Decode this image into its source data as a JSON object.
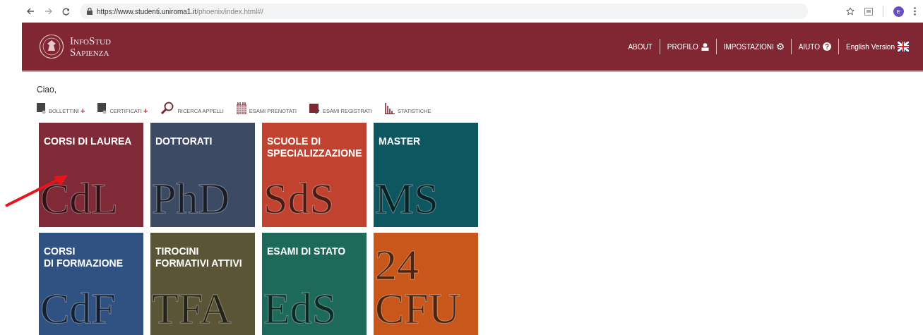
{
  "browser": {
    "url_host": "https://www.studenti.uniroma1.it",
    "url_path": "/phoenix/index.html#/",
    "avatar": "E"
  },
  "header": {
    "logo_lines": [
      "InfoStud",
      "Sapienza"
    ],
    "nav": [
      {
        "label": "ABOUT",
        "kind": "plain"
      },
      {
        "label": "PROFILO",
        "kind": "user"
      },
      {
        "label": "IMPOSTAZIONI",
        "kind": "gear"
      },
      {
        "label": "AIUTO",
        "kind": "help"
      },
      {
        "label": "English Version",
        "kind": "flag"
      }
    ]
  },
  "greeting": "Ciao,",
  "toolbar": [
    {
      "label": "BOLLETTINI",
      "kind": "doc",
      "suffix": "+"
    },
    {
      "label": "CERTIFICATI",
      "kind": "doc",
      "suffix": "+"
    },
    {
      "label": "RICERCA APPELLI",
      "kind": "search"
    },
    {
      "label": "ESAMI PRENOTATI",
      "kind": "calendar"
    },
    {
      "label": "ESAMI REGISTRATI",
      "kind": "register"
    },
    {
      "label": "STATISTICHE",
      "kind": "stats"
    }
  ],
  "tiles": [
    {
      "title": [
        "CORSI DI LAUREA"
      ],
      "mark": [
        "CdL"
      ],
      "color": "#7f2a36"
    },
    {
      "title": [
        "DOTTORATI"
      ],
      "mark": [
        "PhD"
      ],
      "color": "#3c4a63"
    },
    {
      "title": [
        "SCUOLE DI",
        "SPECIALIZZAZIONE"
      ],
      "mark": [
        "SdS"
      ],
      "color": "#c1432f"
    },
    {
      "title": [
        "MASTER"
      ],
      "mark": [
        "MS"
      ],
      "color": "#0e5660"
    },
    {
      "title": [
        "CORSI",
        "DI FORMAZIONE"
      ],
      "mark": [
        "CdF"
      ],
      "color": "#2f5282"
    },
    {
      "title": [
        "TIROCINI",
        "FORMATIVI ATTIVI"
      ],
      "mark": [
        "TFA"
      ],
      "color": "#5a5536"
    },
    {
      "title": [
        "ESAMI DI STATO"
      ],
      "mark": [
        "EdS"
      ],
      "color": "#1d6a5a"
    },
    {
      "mark": [
        "24",
        "CFU"
      ],
      "color": "#c9571c"
    }
  ]
}
